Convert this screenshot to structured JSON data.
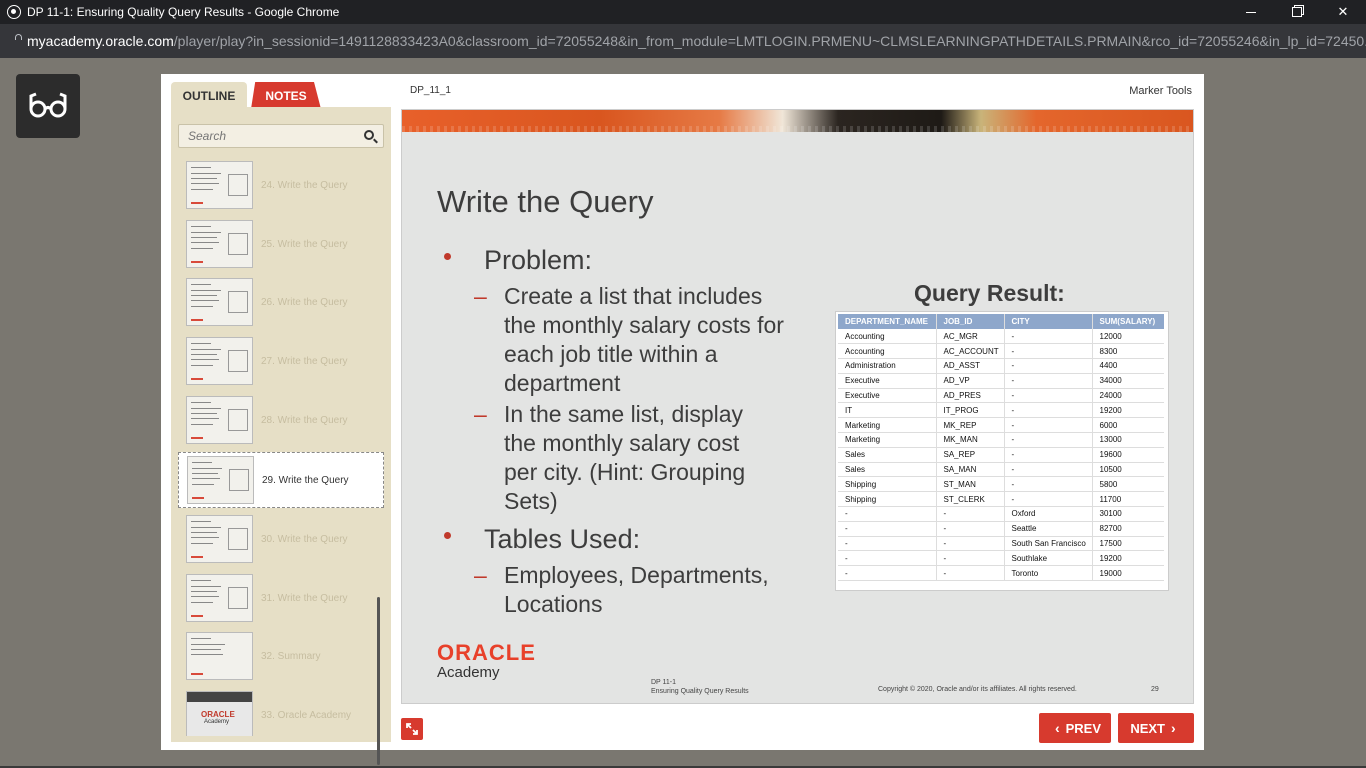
{
  "browser": {
    "window_title": "DP 11-1: Ensuring Quality Query Results - Google Chrome",
    "url_host": "myacademy.oracle.com",
    "url_path": "/player/play?in_sessionid=1491128833423A0&classroom_id=72055248&in_from_module=LMTLOGIN.PRMENU~CLMSLEARNINGPATHDETAILS.PRMAIN&rco_id=72055246&in_lp_id=72450..."
  },
  "sidebar": {
    "tab_outline": "OUTLINE",
    "tab_notes": "NOTES",
    "search_placeholder": "Search",
    "items": [
      {
        "label": "24. Write the Query"
      },
      {
        "label": "25. Write the Query"
      },
      {
        "label": "26. Write the Query"
      },
      {
        "label": "27. Write the Query"
      },
      {
        "label": "28. Write the Query"
      },
      {
        "label": "29. Write the Query",
        "active": true
      },
      {
        "label": "30. Write the Query"
      },
      {
        "label": "31. Write the Query"
      },
      {
        "label": "32. Summary"
      },
      {
        "label": "33. Oracle Academy",
        "thumb_logo": "ORACLE",
        "thumb_sub": "Academy"
      }
    ]
  },
  "header": {
    "slide_id": "DP_11_1",
    "marker_tools": "Marker Tools"
  },
  "slide": {
    "title": "Write the Query",
    "problem_heading": "Problem:",
    "problem_items": [
      "Create a list that includes the monthly salary costs for each job title within a department",
      "In the same list, display the monthly salary cost per city. (Hint: Grouping Sets)"
    ],
    "tables_heading": "Tables Used:",
    "tables_items": [
      "Employees, Departments, Locations"
    ],
    "query_result_label": "Query Result:",
    "result_table": {
      "columns": [
        "DEPARTMENT_NAME",
        "JOB_ID",
        "CITY",
        "SUM(SALARY)"
      ],
      "rows": [
        [
          "Accounting",
          "AC_MGR",
          "-",
          "12000"
        ],
        [
          "Accounting",
          "AC_ACCOUNT",
          "-",
          "8300"
        ],
        [
          "Administration",
          "AD_ASST",
          "-",
          "4400"
        ],
        [
          "Executive",
          "AD_VP",
          "-",
          "34000"
        ],
        [
          "Executive",
          "AD_PRES",
          "-",
          "24000"
        ],
        [
          "IT",
          "IT_PROG",
          "-",
          "19200"
        ],
        [
          "Marketing",
          "MK_REP",
          "-",
          "6000"
        ],
        [
          "Marketing",
          "MK_MAN",
          "-",
          "13000"
        ],
        [
          "Sales",
          "SA_REP",
          "-",
          "19600"
        ],
        [
          "Sales",
          "SA_MAN",
          "-",
          "10500"
        ],
        [
          "Shipping",
          "ST_MAN",
          "-",
          "5800"
        ],
        [
          "Shipping",
          "ST_CLERK",
          "-",
          "11700"
        ],
        [
          "-",
          "-",
          "Oxford",
          "30100"
        ],
        [
          "-",
          "-",
          "Seattle",
          "82700"
        ],
        [
          "-",
          "-",
          "South San Francisco",
          "17500"
        ],
        [
          "-",
          "-",
          "Southlake",
          "19200"
        ],
        [
          "-",
          "-",
          "Toronto",
          "19000"
        ]
      ]
    },
    "logo_oracle": "ORACLE",
    "logo_academy": "Academy",
    "footer_course_code": "DP 11-1",
    "footer_course_title": "Ensuring Quality Query Results",
    "footer_copyright": "Copyright © 2020, Oracle and/or its affiliates. All rights reserved.",
    "footer_page": "29"
  },
  "nav": {
    "prev_label": "PREV",
    "next_label": "NEXT"
  },
  "colors": {
    "accent_red": "#d73a2e",
    "sidebar_bg": "#e6dfc6",
    "table_header": "#8ea7cb"
  }
}
